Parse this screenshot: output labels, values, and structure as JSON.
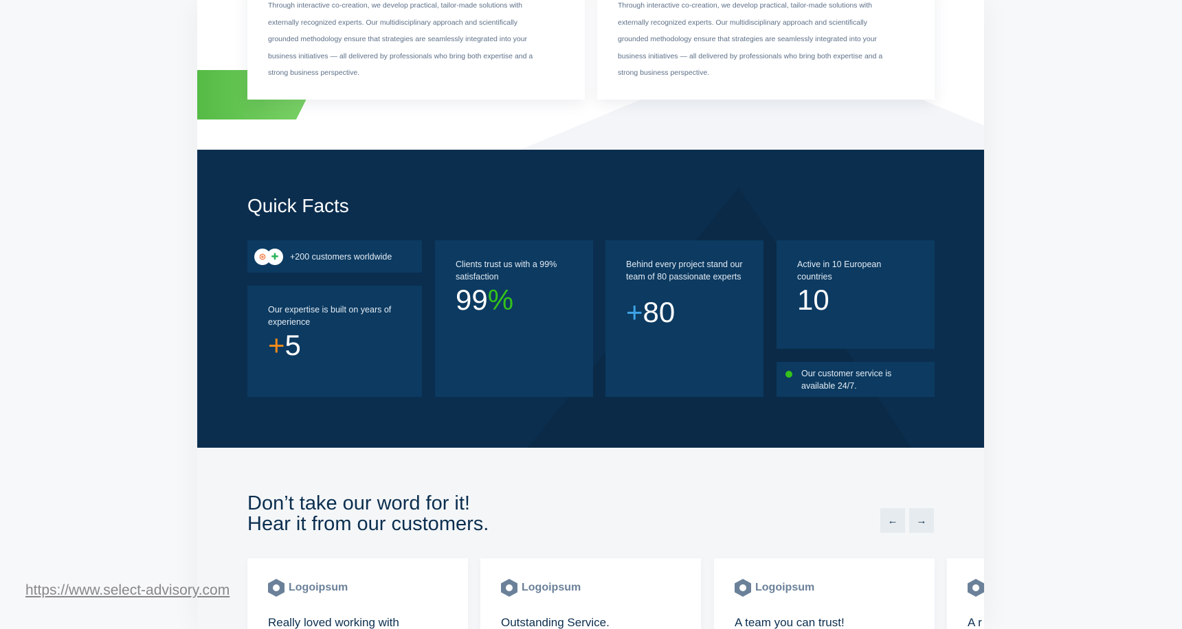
{
  "intro_cards": [
    {
      "lines": [
        "Through interactive co-creation, we develop practical, tailor-made solutions with",
        "externally recognized experts. Our multidisciplinary approach and scientifically",
        "grounded methodology ensure that strategies are seamlessly integrated into your",
        "business initiatives — all delivered by professionals who bring both expertise and a",
        "strong business perspective."
      ]
    },
    {
      "lines": [
        "Through interactive co-creation, we develop practical, tailor-made solutions with",
        "externally recognized experts. Our multidisciplinary approach and scientifically",
        "grounded methodology ensure that strategies are seamlessly integrated into your",
        "business initiatives — all delivered by professionals who bring both expertise and a",
        "strong business perspective."
      ]
    }
  ],
  "quick_facts": {
    "title": "Quick Facts",
    "customers": "+200 customers worldwide",
    "experience": {
      "text": "Our expertise is built on years of experience",
      "prefix": "+",
      "value": "5"
    },
    "satisfaction": {
      "text": "Clients trust us with a 99% satisfaction",
      "value": "99",
      "suffix": "%"
    },
    "team": {
      "text": "Behind every project stand our team of 80 passionate experts",
      "prefix": "+",
      "value": "80"
    },
    "countries": {
      "text": "Active in 10 European countries",
      "value": "10"
    },
    "service": "Our customer service is available 24/7.",
    "colors": {
      "orange": "#f08a1c",
      "green": "#34c21a",
      "blue": "#3ea3e6"
    }
  },
  "testimonials": {
    "heading_line1": "Don’t take our word for it!",
    "heading_line2": "Hear it from our customers.",
    "prev": "←",
    "next": "→",
    "cards": [
      {
        "logo": "Logoipsum",
        "title": "Really loved working with"
      },
      {
        "logo": "Logoipsum",
        "title": "Outstanding Service."
      },
      {
        "logo": "Logoipsum",
        "title": "A team you can trust!"
      },
      {
        "logo": "",
        "title": "A r"
      }
    ]
  },
  "url": "https://www.select-advisory.com"
}
